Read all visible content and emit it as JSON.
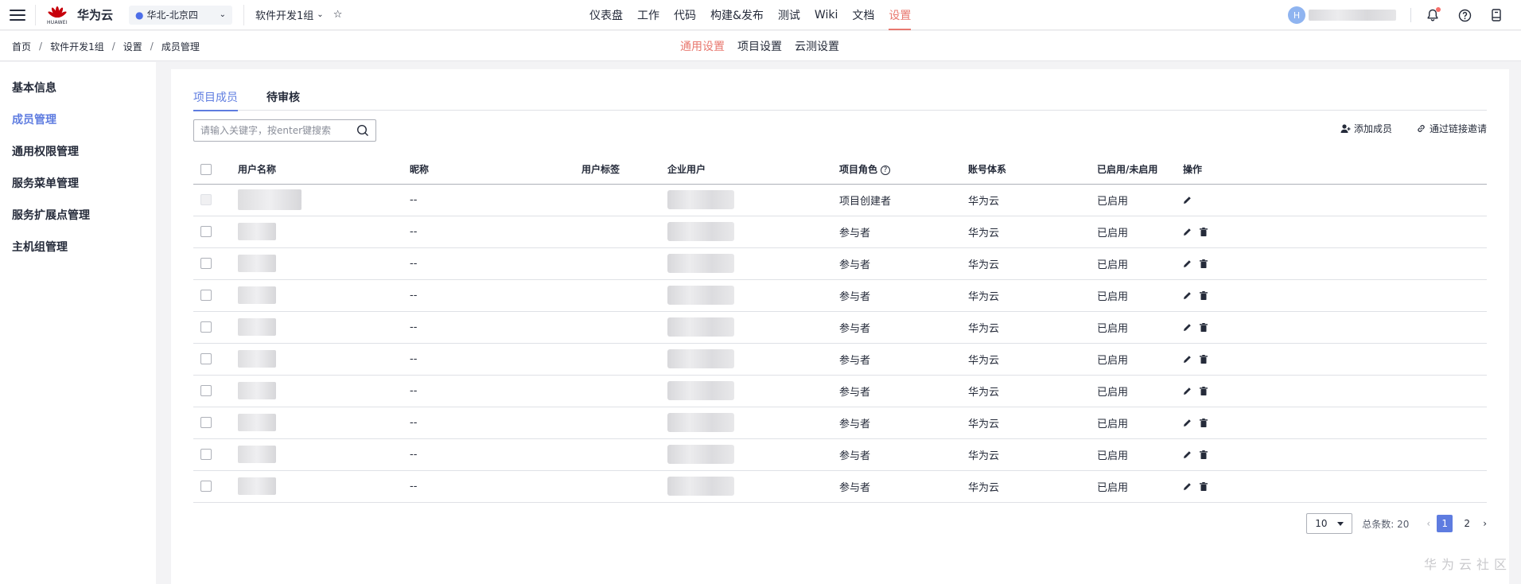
{
  "topbar": {
    "logo_text": "HUAWEI",
    "brand": "华为云",
    "region": "华北-北京四",
    "project": "软件开发1组",
    "nav": [
      "仪表盘",
      "工作",
      "代码",
      "构建&发布",
      "测试",
      "Wiki",
      "文档",
      "设置"
    ],
    "active_nav": "设置",
    "avatar_initial": "H"
  },
  "breadcrumb": [
    "首页",
    "软件开发1组",
    "设置",
    "成员管理"
  ],
  "subtabs": [
    "通用设置",
    "项目设置",
    "云测设置"
  ],
  "sidebar": [
    "基本信息",
    "成员管理",
    "通用权限管理",
    "服务菜单管理",
    "服务扩展点管理",
    "主机组管理"
  ],
  "tabs": [
    "项目成员",
    "待审核"
  ],
  "search": {
    "placeholder": "请输入关键字，按enter键搜索"
  },
  "actions": {
    "add_member": "添加成员",
    "invite_link": "通过链接邀请"
  },
  "table": {
    "headers": {
      "username": "用户名称",
      "nickname": "昵称",
      "tag": "用户标签",
      "enterprise": "企业用户",
      "role": "项目角色",
      "account": "账号体系",
      "status": "已启用/未启用",
      "op": "操作"
    },
    "rows": [
      {
        "nickname": "--",
        "role": "项目创建者",
        "account": "华为云",
        "status": "已启用"
      },
      {
        "nickname": "--",
        "role": "参与者",
        "account": "华为云",
        "status": "已启用"
      },
      {
        "nickname": "--",
        "role": "参与者",
        "account": "华为云",
        "status": "已启用"
      },
      {
        "nickname": "--",
        "role": "参与者",
        "account": "华为云",
        "status": "已启用"
      },
      {
        "nickname": "--",
        "role": "参与者",
        "account": "华为云",
        "status": "已启用"
      },
      {
        "nickname": "--",
        "role": "参与者",
        "account": "华为云",
        "status": "已启用"
      },
      {
        "nickname": "--",
        "role": "参与者",
        "account": "华为云",
        "status": "已启用"
      },
      {
        "nickname": "--",
        "role": "参与者",
        "account": "华为云",
        "status": "已启用"
      },
      {
        "nickname": "--",
        "role": "参与者",
        "account": "华为云",
        "status": "已启用"
      },
      {
        "nickname": "--",
        "role": "参与者",
        "account": "华为云",
        "status": "已启用"
      }
    ]
  },
  "pagination": {
    "page_size": "10",
    "total": "总条数: 20",
    "pages": [
      "1",
      "2"
    ],
    "current": "1"
  },
  "watermark": "华为云社区",
  "colors": {
    "accent": "#5e7ce0",
    "nav_active": "#e8786f",
    "brand_red": "#c7000b"
  }
}
